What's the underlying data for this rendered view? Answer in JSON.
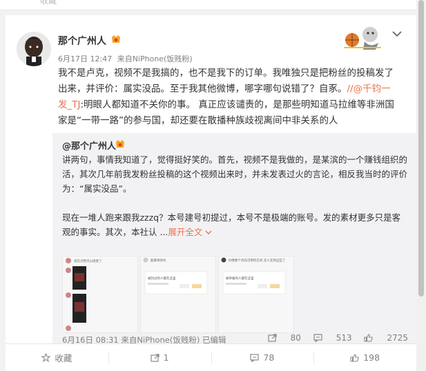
{
  "top_strip": {
    "ghost_label": "收藏"
  },
  "post": {
    "username": "那个广州人",
    "time": "6月17日 12:47",
    "source": "来自NiPhone(饭贱粉)",
    "text_part1": "我不是卢克，视频不是我搞的，也不是我下的订单。我唯独只是把粉丝的投稿发了出来，并评价：属实没品。至于我其他微博，哪字哪句说错了？自豖。",
    "mention": "//@千钧一发_TJ",
    "text_part2": ":明眼人都知道不关你的事。 真正应该谴责的，是那些明知道马拉维等非洲国家是“一带一路”的参与国，却还要在散播种族歧视离间中非关系的人"
  },
  "repost": {
    "username": "@那个广州人",
    "para1": "讲两句，事情我知道了，觉得挺好笑的。首先，视频不是我做的，是某滨的一个赚钱组织的活，其次几年前我发粉丝投稿的这个视频出来时，并未发表过火的言论，相反我当时的评价为：“属实没品”。",
    "para2": "现在一堆人跑来跟我zzzq？本号建号初提过，本号不是极端的账号。发的素材更多只是客观的事实。其次，本社认 ...",
    "expand": "展开全文",
    "time": "6月16日 08:31",
    "source": "来自NiPhone(饭贱粉)",
    "edited": "已编辑",
    "reposts": "80",
    "comments": "513",
    "likes": "2725",
    "thumb_texts": [
      "现在点赞可以接受了",
      "能麻烦你吗",
      "好哦我个优先可用的方式  走人走到这些了",
      "被封过的人都在这里",
      "被举报的人都在这里"
    ]
  },
  "actions": {
    "favorite": "收藏",
    "repost": "1",
    "comment": "78",
    "like": "198"
  }
}
